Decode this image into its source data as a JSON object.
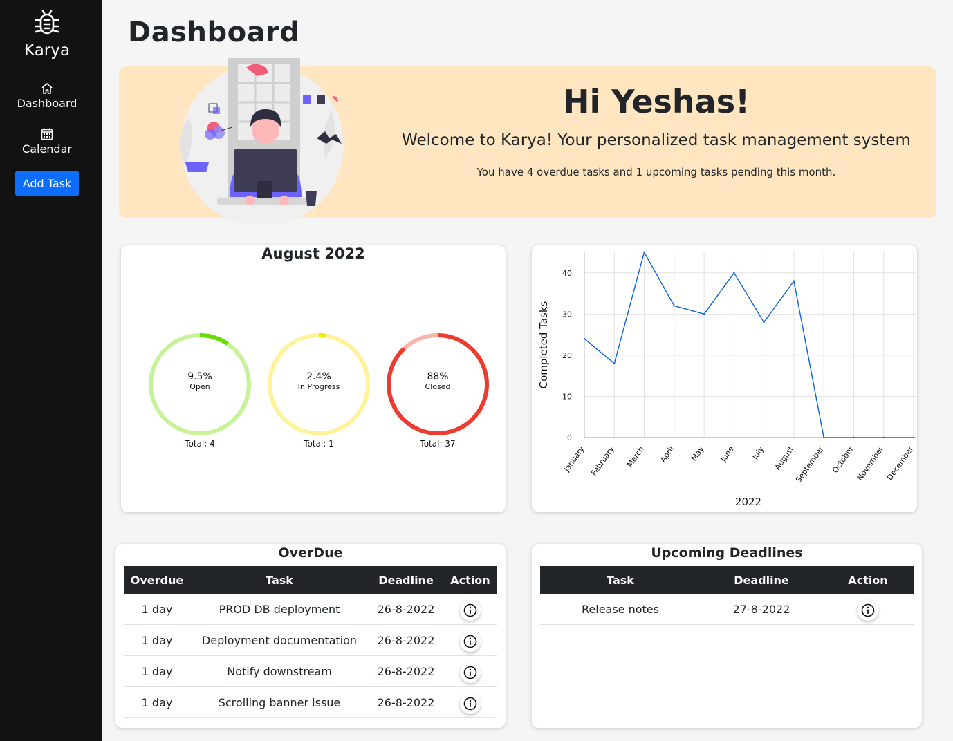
{
  "app": {
    "name": "Karya"
  },
  "sidebar": {
    "items": [
      {
        "label": "Dashboard",
        "icon": "home-icon"
      },
      {
        "label": "Calendar",
        "icon": "calendar-icon"
      }
    ],
    "add_task_label": "Add Task"
  },
  "page": {
    "title": "Dashboard"
  },
  "banner": {
    "greeting": "Hi Yeshas!",
    "welcome": "Welcome to Karya! Your personalized task management system",
    "summary": "You have 4 overdue tasks and 1 upcoming tasks pending this month."
  },
  "month_card": {
    "title": "August 2022",
    "rings": [
      {
        "percent": "9.5%",
        "label": "Open",
        "total": "Total: 4",
        "fraction": 0.095,
        "color": "#66dd00",
        "track": "#c8f29a"
      },
      {
        "percent": "2.4%",
        "label": "In Progress",
        "total": "Total: 1",
        "fraction": 0.024,
        "color": "#eeee00",
        "track": "#fff29a"
      },
      {
        "percent": "88%",
        "label": "Closed",
        "total": "Total: 37",
        "fraction": 0.88,
        "color": "#ee3b30",
        "track": "#f7b5ad"
      }
    ]
  },
  "chart_data": {
    "type": "line",
    "x": [
      "January",
      "February",
      "March",
      "April",
      "May",
      "June",
      "July",
      "August",
      "September",
      "October",
      "November",
      "December"
    ],
    "series": [
      {
        "values": [
          24,
          18,
          45,
          32,
          30,
          40,
          28,
          38,
          0,
          0,
          0,
          0
        ]
      }
    ],
    "xlabel": "2022",
    "ylabel": "Completed Tasks",
    "yticks": [
      "0",
      "10",
      "20",
      "30",
      "40"
    ],
    "ylim": [
      0,
      45
    ],
    "grid": true,
    "color": "#0b63e6"
  },
  "overdue": {
    "title": "OverDue",
    "headers": [
      "Overdue",
      "Task",
      "Deadline",
      "Action"
    ],
    "rows": [
      {
        "overdue": "1 day",
        "task": "PROD DB deployment",
        "deadline": "26-8-2022"
      },
      {
        "overdue": "1 day",
        "task": "Deployment documentation",
        "deadline": "26-8-2022"
      },
      {
        "overdue": "1 day",
        "task": "Notify downstream",
        "deadline": "26-8-2022"
      },
      {
        "overdue": "1 day",
        "task": "Scrolling banner issue",
        "deadline": "26-8-2022"
      }
    ]
  },
  "upcoming": {
    "title": "Upcoming Deadlines",
    "headers": [
      "Task",
      "Deadline",
      "Action"
    ],
    "rows": [
      {
        "task": "Release notes",
        "deadline": "27-8-2022"
      }
    ]
  },
  "colors": {
    "accent": "#0d6efd",
    "sidebar": "#121212",
    "banner": "#ffe6c0",
    "table_header": "#212529"
  }
}
